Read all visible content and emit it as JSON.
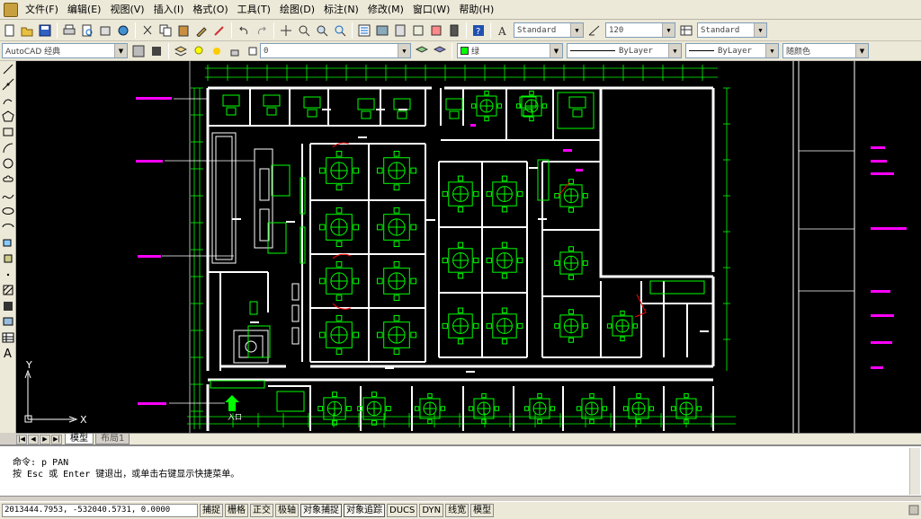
{
  "menubar": {
    "items": [
      "文件(F)",
      "编辑(E)",
      "视图(V)",
      "插入(I)",
      "格式(O)",
      "工具(T)",
      "绘图(D)",
      "标注(N)",
      "修改(M)",
      "窗口(W)",
      "帮助(H)"
    ]
  },
  "toolbar": {
    "text_style": "Standard",
    "dim_scale": "120",
    "table_style": "Standard"
  },
  "toolbar2": {
    "workspace": "AutoCAD 经典",
    "layer": "0",
    "color": "绿",
    "linetype": "ByLayer",
    "lineweight": "ByLayer",
    "plotstyle": "随颜色"
  },
  "canvas": {
    "axis_x": "X",
    "axis_y": "Y",
    "entrance_label": "入口"
  },
  "tabs": [
    "模型",
    "布局1"
  ],
  "command": {
    "line1": "命令: p PAN",
    "line2": "按 Esc 或 Enter 键退出，或单击右键显示快捷菜单。"
  },
  "status": {
    "coords": "2013444.7953, -532040.5731, 0.0000",
    "buttons": [
      "捕捉",
      "栅格",
      "正交",
      "极轴",
      "对象捕捉",
      "对象追踪",
      "DUCS",
      "DYN",
      "线宽",
      "模型"
    ]
  },
  "colors": {
    "canvas_bg": "#000000",
    "wall": "#ffffff",
    "furniture": "#00ff00",
    "annotation": "#ff00ff",
    "door": "#ff0000",
    "dimension": "#00ff00"
  }
}
